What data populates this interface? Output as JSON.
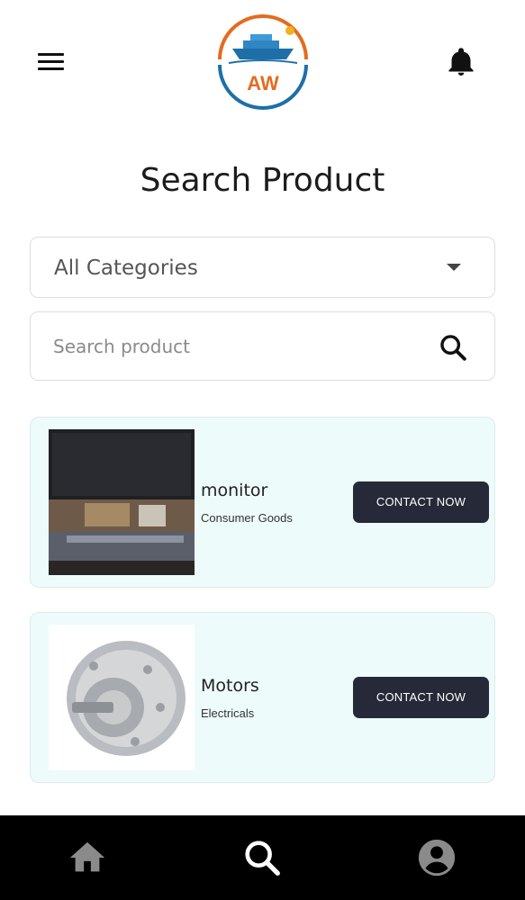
{
  "header": {
    "logo_text": "AW",
    "menu_icon": "hamburger-menu-icon",
    "notification_icon": "bell-icon"
  },
  "page": {
    "title": "Search Product"
  },
  "filters": {
    "category_selected": "All Categories",
    "search_placeholder": "Search product"
  },
  "products": [
    {
      "name": "monitor",
      "category": "Consumer Goods",
      "action_label": "CONTACT NOW"
    },
    {
      "name": "Motors",
      "category": "Electricals",
      "action_label": "CONTACT NOW"
    }
  ],
  "bottom_nav": {
    "items": [
      {
        "icon": "home-icon",
        "active": false
      },
      {
        "icon": "search-icon",
        "active": true
      },
      {
        "icon": "account-icon",
        "active": false
      }
    ]
  },
  "colors": {
    "card_background": "#eefbfb",
    "button_background": "#262a38",
    "nav_background": "#000000",
    "logo_orange": "#e36c1f",
    "logo_blue": "#1e6fa8"
  }
}
